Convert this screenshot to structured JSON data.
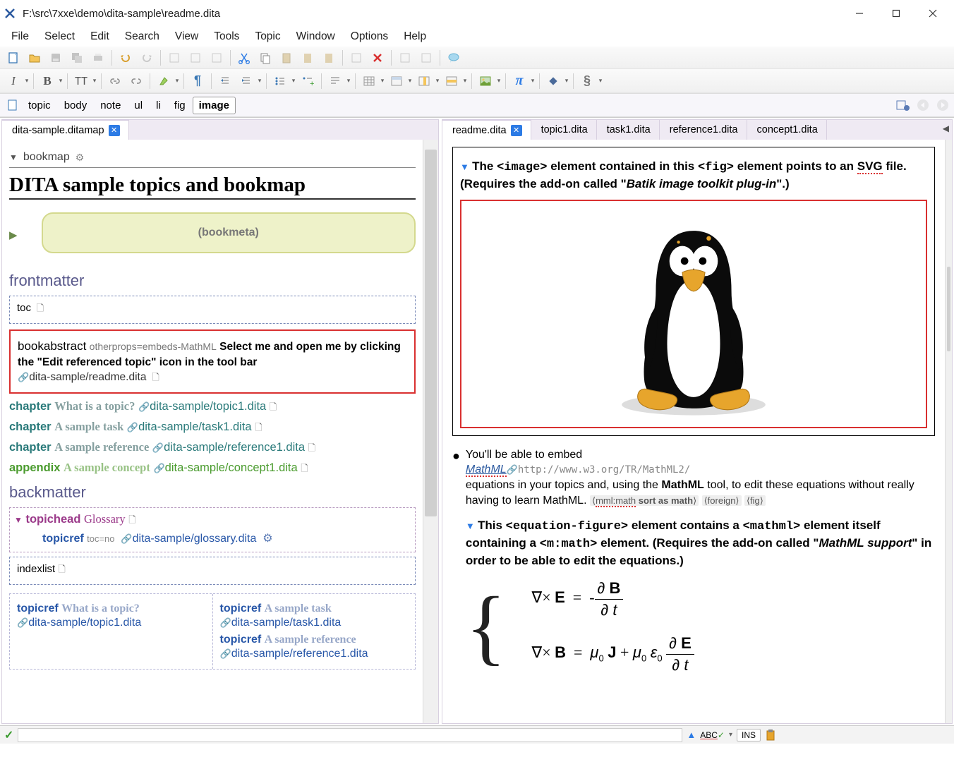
{
  "window": {
    "title": "F:\\src\\7xxe\\demo\\dita-sample\\readme.dita"
  },
  "menu": [
    "File",
    "Select",
    "Edit",
    "Search",
    "View",
    "Tools",
    "Topic",
    "Window",
    "Options",
    "Help"
  ],
  "breadcrumb": [
    "topic",
    "body",
    "note",
    "ul",
    "li",
    "fig",
    "image"
  ],
  "left_pane": {
    "tab": "dita-sample.ditamap",
    "root": "bookmap",
    "title": "DITA sample topics and bookmap",
    "bookmeta": "(bookmeta)",
    "frontmatter": "frontmatter",
    "toc": "toc",
    "bookabstract": {
      "label": "bookabstract",
      "attr": "otherprops=embeds-MathML",
      "text": "Select me and open me by clicking the \"Edit referenced topic\" icon in the tool bar",
      "path": "dita-sample/readme.dita"
    },
    "chapters": [
      {
        "lead": "chapter",
        "title": "What is a topic?",
        "path": "dita-sample/topic1.dita"
      },
      {
        "lead": "chapter",
        "title": "A sample task",
        "path": "dita-sample/task1.dita"
      },
      {
        "lead": "chapter",
        "title": "A sample reference",
        "path": "dita-sample/reference1.dita"
      }
    ],
    "appendix": {
      "lead": "appendix",
      "title": "A sample concept",
      "path": "dita-sample/concept1.dita"
    },
    "backmatter": "backmatter",
    "topichead": {
      "lead": "topichead",
      "title": "Glossary"
    },
    "topicref": {
      "lead": "topicref",
      "attr": "toc=no",
      "path": "dita-sample/glossary.dita"
    },
    "indexlist": "indexlist",
    "grid": [
      {
        "lead": "topicref",
        "title": "What is a topic?",
        "path": "dita-sample/topic1.dita"
      },
      {
        "lead": "topicref",
        "title": "A sample task",
        "path": "dita-sample/task1.dita"
      },
      {
        "lead": "topicref",
        "title": "A sample reference",
        "path": "dita-sample/reference1.dita"
      }
    ]
  },
  "right_pane": {
    "tabs": [
      "readme.dita",
      "topic1.dita",
      "task1.dita",
      "reference1.dita",
      "concept1.dita"
    ],
    "fig_text_a": "The ",
    "fig_text_b": " element contained in this ",
    "fig_text_c": " element points to an ",
    "fig_text_d": " file. (Requires the add-on called \"",
    "fig_text_e": "Batik image toolkit plug-in",
    "fig_text_f": "\".)",
    "fig_svg": "SVG",
    "fig_image": "<image>",
    "fig_fig": "<fig>",
    "bullet_a": "You'll be able to embed ",
    "bullet_link": "MathML",
    "bullet_url": "http://www.w3.org/TR/MathML2/",
    "bullet_b": " equations in your topics and, using the ",
    "bullet_c": "MathML",
    "bullet_d": " tool, to edit these equations without really having to learn MathML.",
    "tags": [
      "mml:math",
      "sort as math",
      "foreign",
      "fig"
    ],
    "eq_intro_a": "This ",
    "eq_intro_b": " element contains a ",
    "eq_intro_c": " element itself containing a ",
    "eq_intro_d": " element. (Requires the add-on called \"",
    "eq_intro_e": "MathML support",
    "eq_intro_f": "\" in order to be able to edit the equations.)",
    "eq_tag1": "<equation-figure>",
    "eq_tag2": "<mathml>",
    "eq_tag3": "<m:math>"
  },
  "status": {
    "ins": "INS"
  }
}
